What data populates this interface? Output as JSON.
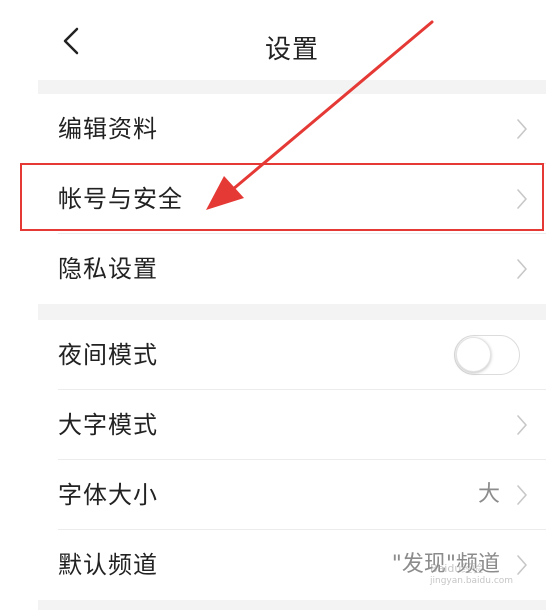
{
  "header": {
    "title": "设置"
  },
  "sections": [
    {
      "rows": [
        {
          "label": "编辑资料",
          "type": "link"
        },
        {
          "label": "帐号与安全",
          "type": "link"
        },
        {
          "label": "隐私设置",
          "type": "link"
        }
      ]
    },
    {
      "rows": [
        {
          "label": "夜间模式",
          "type": "toggle",
          "toggle_on": false
        },
        {
          "label": "大字模式",
          "type": "link"
        },
        {
          "label": "字体大小",
          "type": "value",
          "value": "大"
        },
        {
          "label": "默认频道",
          "type": "value",
          "value": "\"发现\"频道"
        }
      ]
    }
  ],
  "annotation": {
    "highlight_color": "#e53935",
    "target": "帐号与安全"
  },
  "watermark": {
    "text": "Baidu经验",
    "url_text": "jingyan.baidu.com"
  },
  "colors": {
    "background": "#ffffff",
    "section_gap": "#f3f3f3",
    "text": "#222222",
    "secondary_text": "#8c8c8c",
    "chevron": "#c7c7c7",
    "annotation": "#e53935"
  }
}
